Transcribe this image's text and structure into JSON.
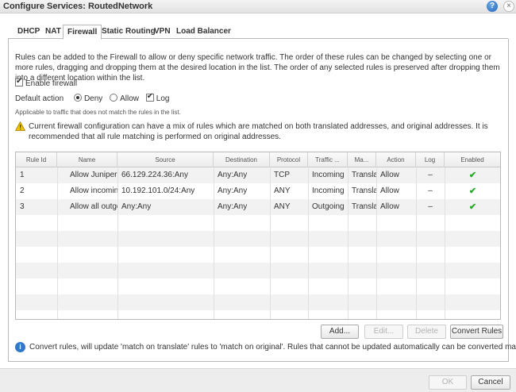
{
  "window": {
    "title": "Configure Services: RoutedNetwork",
    "help_icon": "?",
    "close_icon": "×"
  },
  "tabs": [
    {
      "label": "DHCP",
      "active": false
    },
    {
      "label": "NAT",
      "active": false
    },
    {
      "label": "Firewall",
      "active": true
    },
    {
      "label": "Static Routing",
      "active": false
    },
    {
      "label": "VPN",
      "active": false
    },
    {
      "label": "Load Balancer",
      "active": false
    }
  ],
  "firewall": {
    "description": "Rules can be added to the Firewall to allow or deny specific network traffic. The order of these rules can be changed by selecting one or more rules, dragging and dropping them at the desired location in the list. The order of any selected rules is preserved after dropping them into a different location within the list.",
    "enable_label": "Enable firewall",
    "enable_checked": true,
    "default_action_label": "Default action",
    "deny_label": "Deny",
    "allow_label": "Allow",
    "log_label": "Log",
    "default_action": "Deny",
    "log_checked": true,
    "note": "Applicable to traffic that does not match the rules in the list.",
    "warning": "Current firewall configuration can have a mix of rules which are matched on both translated addresses, and original addresses. It is recommended that all rule matching is performed on original addresses.",
    "info": "Convert rules, will update 'match on translate' rules to 'match on original'. Rules that cannot be updated automatically can be converted manually."
  },
  "table": {
    "columns": [
      "Rule Id",
      "Name",
      "Source",
      "Destination",
      "Protocol",
      "Traffic ...",
      "Ma...",
      "Action",
      "Log",
      "Enabled"
    ],
    "rows": [
      {
        "id": "1",
        "name": "Allow Juniper Ir",
        "source": "66.129.224.36:Any",
        "destination": "Any:Any",
        "protocol": "TCP",
        "traffic": "Incoming",
        "match": "Transla",
        "action": "Allow",
        "log": "–",
        "enabled": "✔"
      },
      {
        "id": "2",
        "name": "Allow incoming",
        "source": "10.192.101.0/24:Any",
        "destination": "Any:Any",
        "protocol": "ANY",
        "traffic": "Incoming",
        "match": "Transla",
        "action": "Allow",
        "log": "–",
        "enabled": "✔"
      },
      {
        "id": "3",
        "name": "Allow all outgoi",
        "source": "Any:Any",
        "destination": "Any:Any",
        "protocol": "ANY",
        "traffic": "Outgoing",
        "match": "Transla",
        "action": "Allow",
        "log": "–",
        "enabled": "✔"
      }
    ]
  },
  "buttons": {
    "add": "Add...",
    "edit": "Edit...",
    "delete": "Delete",
    "convert": "Convert Rules",
    "ok": "OK",
    "cancel": "Cancel"
  },
  "colors": {
    "enabled_check": "#2aa52a",
    "info_icon": "#2f79c9",
    "warning_icon": "#f2c200"
  }
}
